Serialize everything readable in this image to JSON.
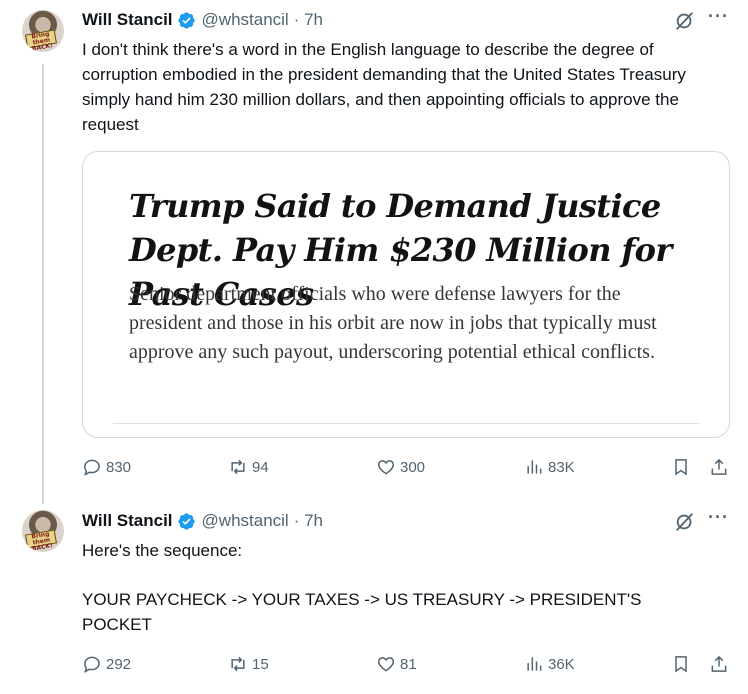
{
  "colors": {
    "text": "#0f1419",
    "secondary": "#536471",
    "verified": "#1d9bf0",
    "border": "#cfd9de"
  },
  "tweets": [
    {
      "author_name": "Will Stancil",
      "handle": "@whstancil",
      "time": "· 7h",
      "avatar_sign_text": "Bring them BACK!",
      "text": "I don't think there's a word in the English language to describe the degree of corruption embodied in the president demanding that the United States Treasury simply hand him 230 million dollars, and then appointing officials to approve the request",
      "card": {
        "headline": "Trump Said to Demand Justice Dept. Pay Him $230 Million for Past Cases",
        "summary": "Senior department officials who were defense lawyers for the president and those in his orbit are now in jobs that typically must approve any such payout, underscoring potential ethical conflicts."
      },
      "stats": {
        "replies": "830",
        "reposts": "94",
        "likes": "300",
        "views": "83K"
      }
    },
    {
      "author_name": "Will Stancil",
      "handle": "@whstancil",
      "time": "· 7h",
      "avatar_sign_text": "Bring them BACK!",
      "text_line1": "Here's the sequence:",
      "text_line2": "YOUR PAYCHECK -> YOUR TAXES -> US TREASURY -> PRESIDENT'S POCKET",
      "stats": {
        "replies": "292",
        "reposts": "15",
        "likes": "81",
        "views": "36K"
      }
    }
  ],
  "icons": {
    "more": "more-icon",
    "grok": "grok-icon",
    "reply": "reply-icon",
    "repost": "repost-icon",
    "like": "like-icon",
    "views": "views-icon",
    "bookmark": "bookmark-icon",
    "share": "share-icon"
  }
}
